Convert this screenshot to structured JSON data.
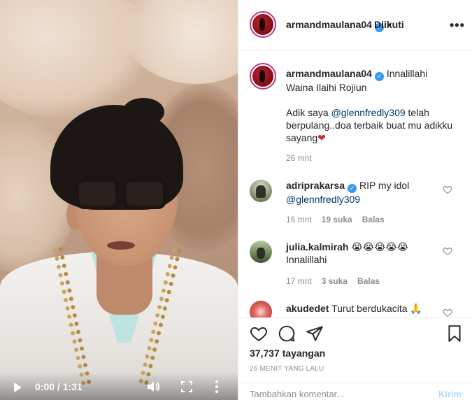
{
  "video": {
    "time": "0:00 / 1:31",
    "icons": [
      "play-icon",
      "volume-icon",
      "fullscreen-icon",
      "more-vertical-icon"
    ]
  },
  "header": {
    "username": "armandmaulana04",
    "separator": "•",
    "follow_status": "Diikuti",
    "menu": "•••"
  },
  "caption": {
    "username": "armandmaulana04",
    "line1": "Innalillahi",
    "line2": "Waina Ilaihi Rojiun",
    "line3_before": "Adik saya ",
    "mention": "@glennfredly309",
    "line3_after": " telah berpulang..doa terbaik buat mu adikku sayang",
    "emoji": "❤",
    "time": "26 mnt"
  },
  "comments": [
    {
      "username": "adriprakarsa",
      "text": "RIP my idol",
      "mention": "@glennfredly309",
      "time": "16 mnt",
      "likes": "19 suka",
      "reply": "Balas"
    },
    {
      "username": "julia.kalmirah",
      "text": "😭😭😭😭😭",
      "text2": "Innalillahi",
      "time": "17 mnt",
      "likes": "3 suka",
      "reply": "Balas"
    },
    {
      "username": "akudedet",
      "text": "Turut berdukacita 🙏"
    }
  ],
  "actions": {
    "views": "37,737 tayangan",
    "ago": "26 MENIT YANG LALU"
  },
  "add_comment": {
    "placeholder": "Tambahkan komentar...",
    "post": "Kirim"
  },
  "colors": {
    "link": "#00376b",
    "verified": "#3897f0",
    "muted": "#8e8e8e",
    "post_disabled": "#b3dbff"
  }
}
